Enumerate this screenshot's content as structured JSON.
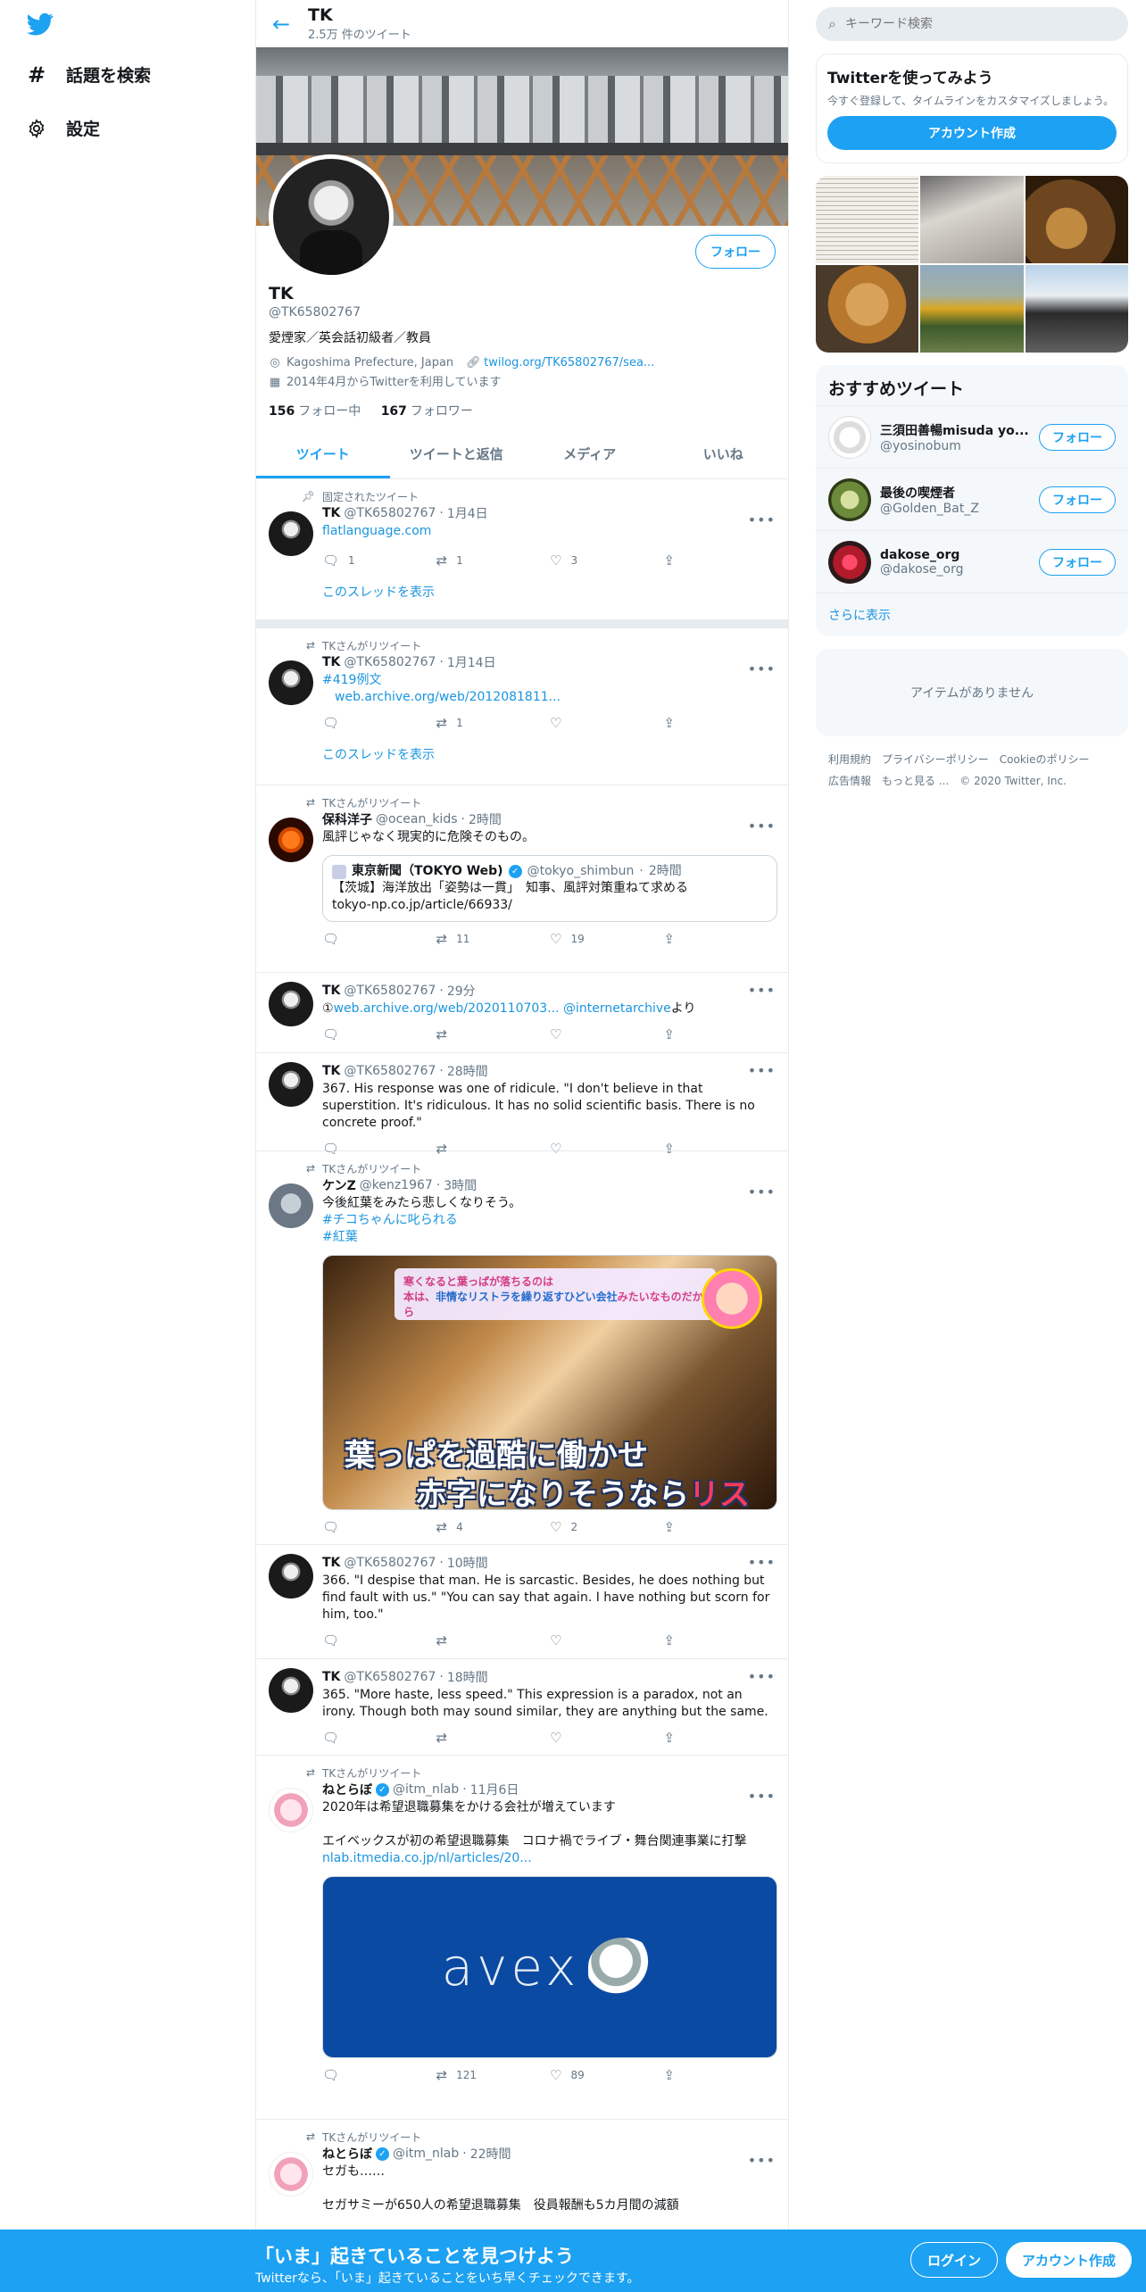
{
  "nav": {
    "logo": "twitter-bird-icon",
    "items": [
      {
        "label": "話題を検索",
        "icon": "hash-icon"
      },
      {
        "label": "設定",
        "icon": "gear-icon"
      }
    ]
  },
  "header": {
    "title": "TK",
    "subtitle": "2.5万 件のツイート"
  },
  "profile": {
    "name": "TK",
    "handle": "@TK65802767",
    "bio": "愛煙家／英会話初級者／教員",
    "location": "Kagoshima Prefecture, Japan",
    "website": "twilog.org/TK65802767/sea...",
    "joined": "2014年4月からTwitterを利用しています",
    "following_count": "156",
    "following_label": "フォロー中",
    "followers_count": "167",
    "followers_label": "フォロワー",
    "follow_label": "フォロー"
  },
  "tabs": [
    "ツイート",
    "ツイートと返信",
    "メディア",
    "いいね"
  ],
  "tweets": [
    {
      "context": "固定されたツイート",
      "name": "TK",
      "handle": "@TK65802767",
      "time": "1月4日",
      "text": "flatlanguage.com",
      "reply": "1",
      "retweet": "1",
      "like": "3",
      "thread": "このスレッドを表示"
    },
    {
      "context": "TKさんがリツイート",
      "name": "TK",
      "handle": "@TK65802767",
      "time": "1月14日",
      "line1": "#419例文",
      "line2": "web.archive.org/web/2012081811...",
      "reply": "",
      "retweet": "1",
      "like": "",
      "thread": "このスレッドを表示"
    },
    {
      "context": "TKさんがリツイート",
      "name": "保科洋子",
      "handle": "@ocean_kids",
      "time": "2時間",
      "text": "風評じゃなく現実的に危険そのもの。",
      "quote": {
        "name": "東京新聞（TOKYO Web)",
        "handle": "@tokyo_shimbun",
        "time": "2時間",
        "text": "【茨城】海洋放出「姿勢は一貫」　知事、風評対策重ねて求める",
        "link": "tokyo-np.co.jp/article/66933/"
      },
      "reply": "",
      "retweet": "11",
      "like": "19"
    },
    {
      "name": "TK",
      "handle": "@TK65802767",
      "time": "29分",
      "prefix": "①",
      "link": "web.archive.org/web/2020110703...",
      "mention": "@internetarchive",
      "suffix": "より"
    },
    {
      "name": "TK",
      "handle": "@TK65802767",
      "time": "28時間",
      "text": "367. His response was one of ridicule. \"I don't believe in that superstition. It's ridiculous. It has no solid scientific basis. There is no concrete proof.\""
    },
    {
      "context": "TKさんがリツイート",
      "name": "ケンZ",
      "handle": "@kenz1967",
      "time": "3時間",
      "text": "今後紅葉をみたら悲しくなりそう。",
      "tag1": "#チコちゃんに叱られる",
      "tag2": "#紅葉",
      "media": {
        "top": "寒くなると葉っぱが落ちるのは",
        "top2a": "本は、",
        "top2b": "非情なリストラを繰り返すひどい会社",
        "top2c": "みたいなものだから",
        "cap1": "葉っぱを過酷に働かせ",
        "cap2a": "赤字になりそうなら",
        "cap2b": "リストラ"
      },
      "reply": "",
      "retweet": "4",
      "like": "2"
    },
    {
      "name": "TK",
      "handle": "@TK65802767",
      "time": "10時間",
      "text": "366. \"I despise that man. He is sarcastic. Besides, he does nothing but find fault with us.\" \"You can say that again. I have nothing but scorn for him, too.\""
    },
    {
      "name": "TK",
      "handle": "@TK65802767",
      "time": "18時間",
      "text": "365. \"More haste, less speed.\" This expression is a paradox, not an irony. Though both may sound similar, they are anything but the same."
    },
    {
      "context": "TKさんがリツイート",
      "name": "ねとらぼ",
      "handle": "@itm_nlab",
      "time": "11月6日",
      "text": "2020年は希望退職募集をかける会社が増えています",
      "text2": "エイベックスが初の希望退職募集　コロナ禍でライブ・舞台関連事業に打撃",
      "link": "nlab.itmedia.co.jp/nl/articles/20...",
      "media_text": "avex",
      "reply": "",
      "retweet": "121",
      "like": "89"
    },
    {
      "context": "TKさんがリツイート",
      "name": "ねとらぼ",
      "handle": "@itm_nlab",
      "time": "22時間",
      "text": "セガも……",
      "text2": "セガサミーが650人の希望退職募集　役員報酬も5カ月間の減額"
    }
  ],
  "right": {
    "search_placeholder": "キーワード検索",
    "signup_title": "Twitterを使ってみよう",
    "signup_text": "今すぐ登録して、タイムラインをカスタマイズしましょう。",
    "signup_button": "アカウント作成",
    "rec_title": "おすすめツイート",
    "recs": [
      {
        "name": "三須田善暢misuda yo...",
        "handle": "@yosinobum"
      },
      {
        "name": "最後の喫煙者",
        "handle": "@Golden_Bat_Z"
      },
      {
        "name": "dakose_org",
        "handle": "@dakose_org"
      }
    ],
    "rec_follow": "フォロー",
    "more": "さらに表示",
    "empty": "アイテムがありません",
    "footer1": [
      "利用規約",
      "プライバシーポリシー",
      "Cookieのポリシー"
    ],
    "footer2": [
      "広告情報",
      "もっと見る ...",
      "© 2020 Twitter, Inc."
    ]
  },
  "bottom": {
    "title": "「いま」起きていることを見つけよう",
    "subtitle": "Twitterなら、「いま」起きていることをいち早くチェックできます。",
    "login": "ログイン",
    "signup": "アカウント作成"
  },
  "colors": {
    "accent": "#1da1f2",
    "text": "#14171a",
    "secondary": "#657786",
    "border": "#e6ecf0"
  }
}
